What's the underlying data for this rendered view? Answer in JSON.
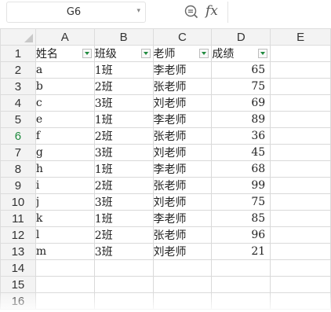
{
  "formula_bar": {
    "name_box_value": "G6",
    "zoom_icon": "zoom-search-icon",
    "fx_label": "fx"
  },
  "columns": [
    "A",
    "B",
    "C",
    "D",
    "E"
  ],
  "row_numbers": [
    "1",
    "2",
    "3",
    "4",
    "5",
    "6",
    "7",
    "8",
    "9",
    "10",
    "11",
    "12",
    "13",
    "14",
    "15",
    "16"
  ],
  "active_row": "6",
  "headers": {
    "a": "姓名",
    "b": "班级",
    "c": "老师",
    "d": "成绩"
  },
  "rows": [
    {
      "name": "a",
      "class": "1班",
      "teacher": "李老师",
      "score": "65"
    },
    {
      "name": "b",
      "class": "2班",
      "teacher": "张老师",
      "score": "75"
    },
    {
      "name": "c",
      "class": "3班",
      "teacher": "刘老师",
      "score": "69"
    },
    {
      "name": "e",
      "class": "1班",
      "teacher": "李老师",
      "score": "89"
    },
    {
      "name": "f",
      "class": "2班",
      "teacher": "张老师",
      "score": "36"
    },
    {
      "name": "g",
      "class": "3班",
      "teacher": "刘老师",
      "score": "45"
    },
    {
      "name": "h",
      "class": "1班",
      "teacher": "李老师",
      "score": "68"
    },
    {
      "name": "i",
      "class": "2班",
      "teacher": "张老师",
      "score": "99"
    },
    {
      "name": "j",
      "class": "3班",
      "teacher": "刘老师",
      "score": "75"
    },
    {
      "name": "k",
      "class": "1班",
      "teacher": "李老师",
      "score": "85"
    },
    {
      "name": "l",
      "class": "2班",
      "teacher": "张老师",
      "score": "96"
    },
    {
      "name": "m",
      "class": "3班",
      "teacher": "刘老师",
      "score": "21"
    }
  ],
  "colors": {
    "active_row_header": "#1f8a3e",
    "filter_arrow": "#1f8a3e",
    "header_bg": "#f3f3f3",
    "grid_line": "#d9d9d9"
  }
}
